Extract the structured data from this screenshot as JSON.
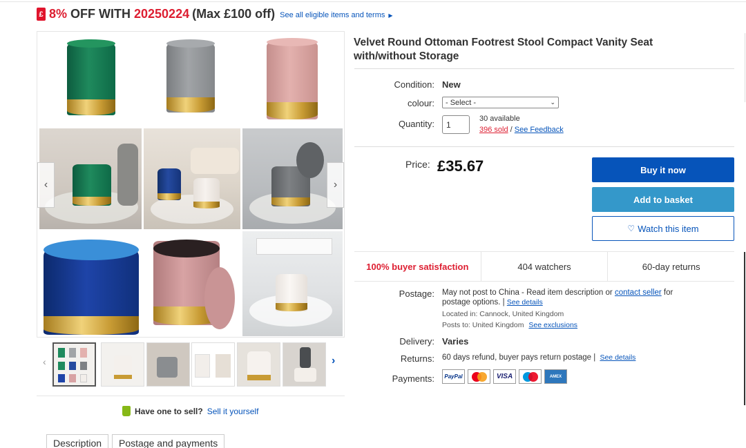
{
  "promo": {
    "percent": "8%",
    "off_with": "OFF WITH",
    "code": "20250224",
    "max": "(Max £100 off)",
    "link": "See all eligible items and terms"
  },
  "product": {
    "title": "Velvet Round Ottoman Footrest Stool Compact Vanity Seat with/without Storage"
  },
  "details": {
    "condition_label": "Condition:",
    "condition_value": "New",
    "colour_label": "colour:",
    "colour_select": "- Select -",
    "quantity_label": "Quantity:",
    "quantity_value": "1",
    "available": "30 available",
    "sold": "396 sold",
    "sold_sep": "/",
    "feedback": "See Feedback"
  },
  "price": {
    "label": "Price:",
    "value": "£35.67"
  },
  "buttons": {
    "buy": "Buy it now",
    "basket": "Add to basket",
    "watch": "Watch this item"
  },
  "stats": {
    "satisfaction": "100% buyer satisfaction",
    "watchers": "404 watchers",
    "returns": "60-day returns"
  },
  "postage": {
    "label": "Postage:",
    "text1": "May not post to China - Read item description or",
    "contact": "contact seller",
    "text2": "for",
    "text3": "postage options. |",
    "see_details": "See details",
    "located": "Located in: Cannock, United Kingdom",
    "posts_to": "Posts to: United Kingdom",
    "exclusions": "See exclusions"
  },
  "delivery": {
    "label": "Delivery:",
    "value": "Varies"
  },
  "returns": {
    "label": "Returns:",
    "value": "60 days refund, buyer pays return postage |",
    "see_details": "See details"
  },
  "payments": {
    "label": "Payments:",
    "methods": [
      "PayPal",
      "Mastercard",
      "VISA",
      "Maestro",
      "American Express"
    ]
  },
  "sell": {
    "question": "Have one to sell?",
    "link": "Sell it yourself"
  },
  "tabs": [
    "Description",
    "Postage and payments"
  ],
  "colors": {
    "accent_blue": "#0654ba",
    "basket_blue": "#3498ca",
    "promo_red": "#dd1e31"
  },
  "icons": [
    "promo-tag-icon",
    "chevron-left-icon",
    "chevron-right-icon",
    "heart-icon",
    "sell-tag-icon",
    "select-arrow-icon"
  ]
}
